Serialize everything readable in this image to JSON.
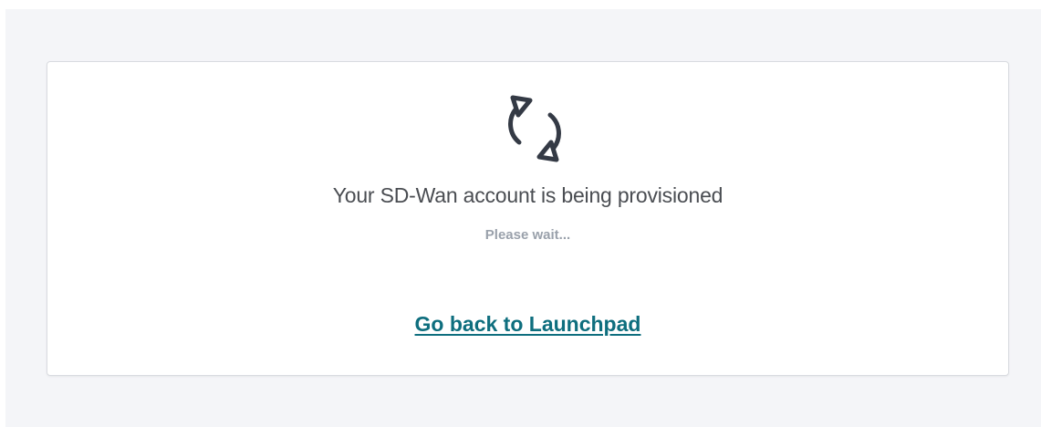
{
  "status_card": {
    "icon": "refresh-icon",
    "title": "Your SD-Wan account is being provisioned",
    "subtitle": "Please wait...",
    "link_label": "Go back to Launchpad"
  },
  "colors": {
    "page_background": "#f4f5f8",
    "card_background": "#ffffff",
    "icon": "#343a45",
    "title": "#4a4d52",
    "subtitle": "#9aa1ab",
    "link": "#0e6e7e"
  }
}
